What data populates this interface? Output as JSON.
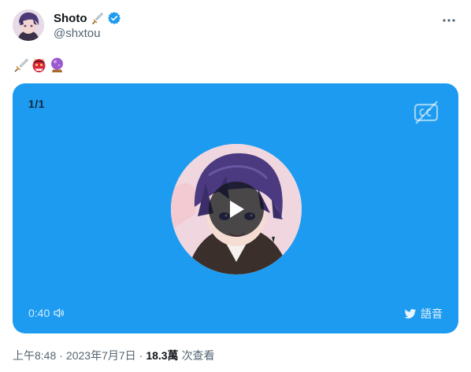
{
  "author": {
    "display_name": "Shoto",
    "name_emoji": "dagger",
    "verified": true,
    "handle": "@shxtou"
  },
  "tweet": {
    "emojis": [
      "dagger",
      "japanese-ogre",
      "crystal-ball"
    ]
  },
  "media": {
    "counter": "1/1",
    "duration": "0:40",
    "brand_label": "語音",
    "accent_color": "#1d9bf0"
  },
  "meta": {
    "time": "上午8:48",
    "separator": "·",
    "date": "2023年7月7日",
    "views_count": "18.3萬",
    "views_label": "次查看"
  }
}
